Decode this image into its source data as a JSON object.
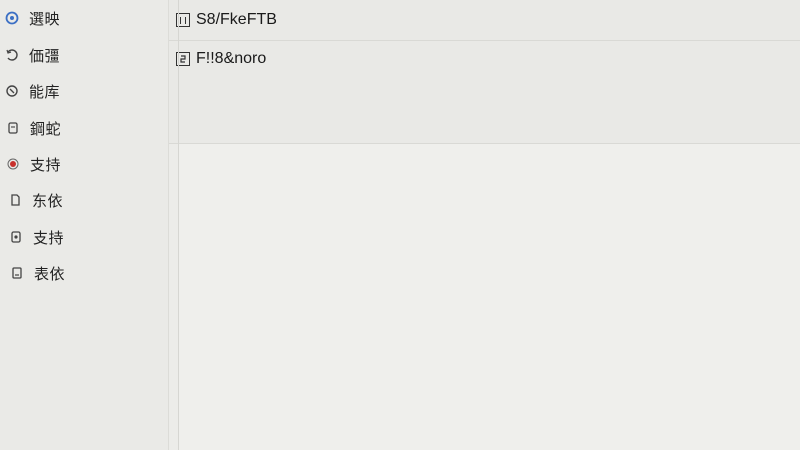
{
  "sidebar": {
    "items": [
      {
        "label": "選映",
        "icon": "globe-icon",
        "icon_color": "#3b6fc4"
      },
      {
        "label": "価彊",
        "icon": "refresh-icon",
        "icon_color": "#444444"
      },
      {
        "label": "能库",
        "icon": "sync-icon",
        "icon_color": "#444444"
      },
      {
        "label": "鋼蛇",
        "icon": "document-icon",
        "icon_color": "#444444"
      },
      {
        "label": "支持",
        "icon": "record-icon",
        "icon_color": "#c8302c"
      },
      {
        "label": "东依",
        "icon": "file-icon",
        "icon_color": "#444444"
      },
      {
        "label": "支持",
        "icon": "settings-icon",
        "icon_color": "#444444"
      },
      {
        "label": "表依",
        "icon": "list-icon",
        "icon_color": "#444444"
      }
    ]
  },
  "main": {
    "rows": [
      {
        "label": "S8/FkeFTB",
        "icon": "panel-icon"
      },
      {
        "label": "F!!8&noro",
        "icon": "item-icon"
      }
    ]
  }
}
